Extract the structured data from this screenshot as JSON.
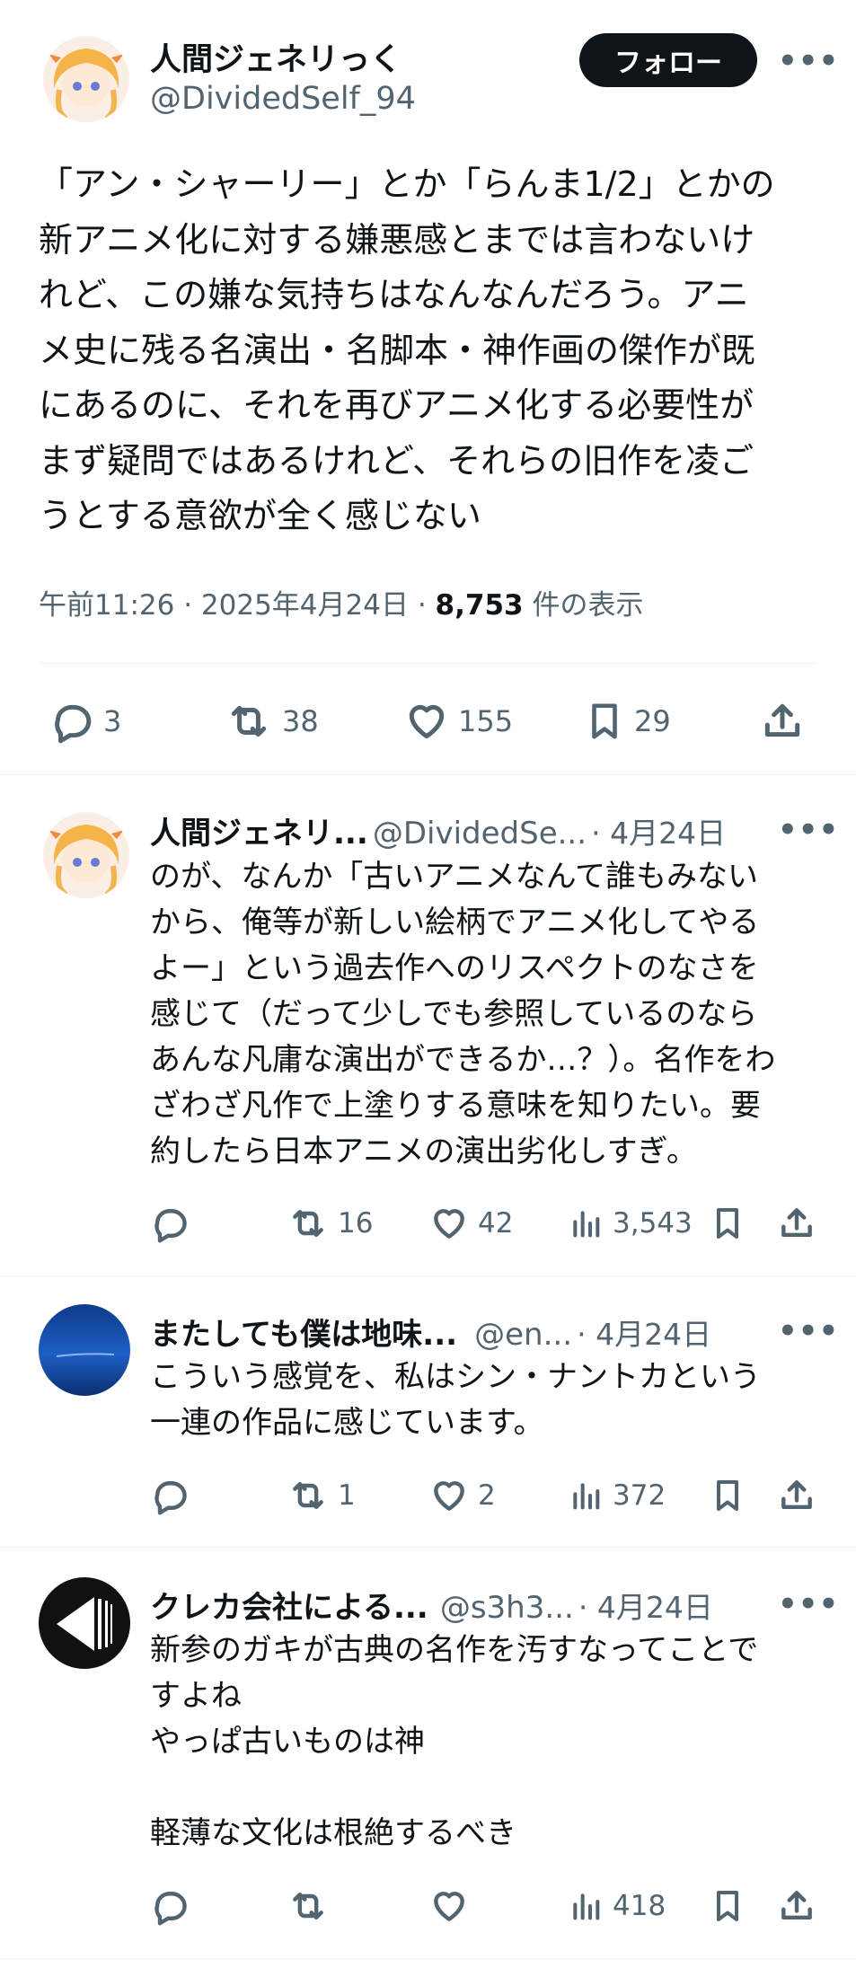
{
  "main": {
    "name": "人間ジェネリっく",
    "handle": "@DividedSelf_94",
    "follow_label": "フォロー",
    "more": "•••",
    "text": "「アン・シャーリー」とか「らんま1/2」とかの\n新アニメ化に対する嫌悪感とまでは言わないけ\nれど、この嫌な気持ちはなんなんだろう。アニ\nメ史に残る名演出・名脚本・神作画の傑作が既\nにあるのに、それを再びアニメ化する必要性が\nまず疑問ではあるけれど、それらの旧作を凌ご\nうとする意欲が全く感じない",
    "time": "午前11:26 · 2025年4月24日 · ",
    "views": "8,753",
    "views_suffix": " 件の表示",
    "stats": {
      "replies": "3",
      "retweets": "38",
      "likes": "155",
      "bookmarks": "29"
    }
  },
  "replies": [
    {
      "name": "人間ジェネリ...",
      "handle": "@DividedSe...",
      "date": "· 4月24日",
      "more": "•••",
      "text": "のが、なんか「古いアニメなんて誰もみない\nから、俺等が新しい絵柄でアニメ化してやる\nよー」という過去作へのリスペクトのなさを\n感じて（だって少しでも参照しているのなら\nあんな凡庸な演出ができるか…？）。名作をわ\nざわざ凡作で上塗りする意味を知りたい。要\n約したら日本アニメの演出劣化しすぎ。",
      "stats": {
        "replies": "",
        "retweets": "16",
        "likes": "42",
        "views": "3,543"
      }
    },
    {
      "name": "またしても僕は地味...",
      "handle": "@en...",
      "date": "· 4月24日",
      "more": "•••",
      "text": "こういう感覚を、私はシン・ナントカという\n一連の作品に感じています。",
      "stats": {
        "replies": "",
        "retweets": "1",
        "likes": "2",
        "views": "372"
      }
    },
    {
      "name": "クレカ会社による...",
      "handle": "@s3h3...",
      "date": "· 4月24日",
      "more": "•••",
      "text": "新参のガキが古典の名作を汚すなってことで\nすよね\nやっぱ古いものは神\n\n軽薄な文化は根絶するべき",
      "stats": {
        "replies": "",
        "retweets": "",
        "likes": "",
        "views": "418"
      }
    }
  ],
  "icons": [
    "reply-icon",
    "retweet-icon",
    "like-icon",
    "views-icon",
    "bookmark-icon",
    "share-icon",
    "more-icon"
  ]
}
